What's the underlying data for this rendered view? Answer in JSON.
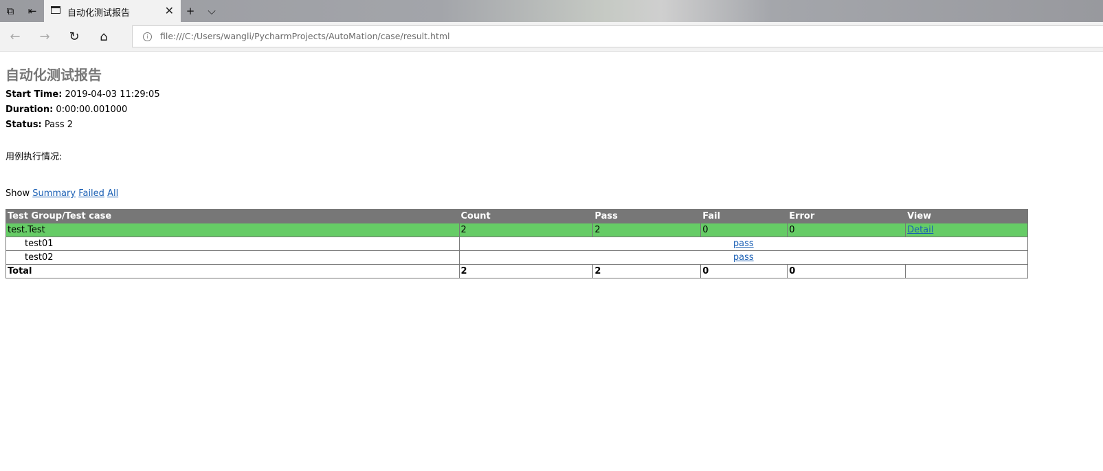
{
  "browser": {
    "tab": {
      "title": "自动化测试报告"
    },
    "address": {
      "url": "file:///C:/Users/wangli/PycharmProjects/AutoMation/case/result.html"
    }
  },
  "report": {
    "title": "自动化测试报告",
    "attributes": [
      {
        "name": "Start Time:",
        "value": " 2019-04-03 11:29:05"
      },
      {
        "name": "Duration:",
        "value": " 0:00:00.001000"
      },
      {
        "name": "Status:",
        "value": " Pass 2"
      }
    ],
    "section_label": "用例执行情况:",
    "show": {
      "label": "Show",
      "summary": "Summary",
      "failed": "Failed",
      "all": "All"
    },
    "table": {
      "headers": [
        "Test Group/Test case",
        "Count",
        "Pass",
        "Fail",
        "Error",
        "View"
      ],
      "group": {
        "name": "test.Test",
        "count": "2",
        "pass": "2",
        "fail": "0",
        "error": "0",
        "view": "Detail"
      },
      "cases": [
        {
          "name": "test01",
          "status": "pass"
        },
        {
          "name": "test02",
          "status": "pass"
        }
      ],
      "total": {
        "label": "Total",
        "count": "2",
        "pass": "2",
        "fail": "0",
        "error": "0"
      }
    }
  },
  "colors": {
    "header_bg": "#777777",
    "pass_group_bg": "#66cc66",
    "title_color": "#777777",
    "link_color": "#1a5fb4"
  }
}
